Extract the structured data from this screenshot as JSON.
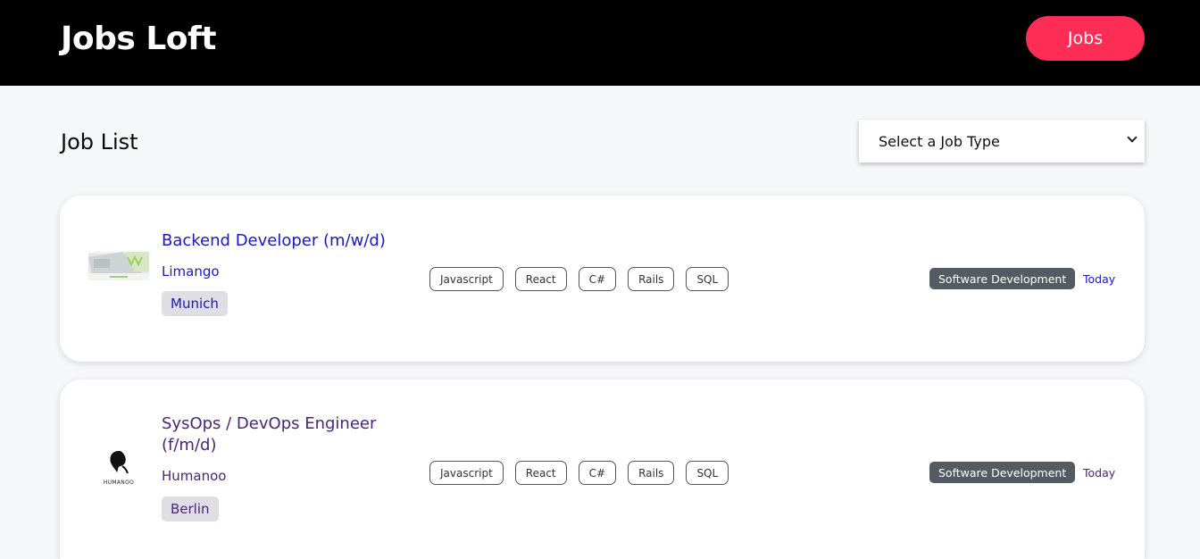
{
  "header": {
    "brand": "Jobs Loft",
    "nav_button": "Jobs"
  },
  "page": {
    "title": "Job List",
    "job_type_select": "Select a Job Type"
  },
  "jobs": [
    {
      "title": "Backend Developer (m/w/d)",
      "company": "Limango",
      "location": "Munich",
      "logo_caption": "limango",
      "tags": [
        "Javascript",
        "React",
        "C#",
        "Rails",
        "SQL"
      ],
      "category": "Software Development",
      "posted": "Today"
    },
    {
      "title": "SysOps / DevOps Engineer (f/m/d)",
      "company": "Humanoo",
      "location": "Berlin",
      "logo_caption": "HUMANOO",
      "tags": [
        "Javascript",
        "React",
        "C#",
        "Rails",
        "SQL"
      ],
      "category": "Software Development",
      "posted": "Today"
    }
  ],
  "colors": {
    "header_bg": "#000000",
    "accent": "#fd2d55",
    "job1_text": "#1a17c7",
    "job2_text": "#4a2579",
    "category_badge": "#545b63"
  }
}
